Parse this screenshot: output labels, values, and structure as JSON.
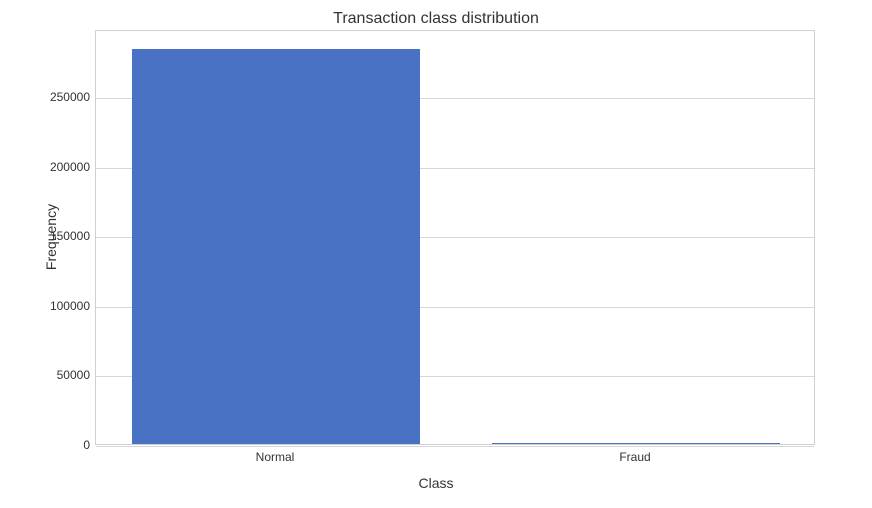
{
  "chart_data": {
    "type": "bar",
    "title": "Transaction class distribution",
    "xlabel": "Class",
    "ylabel": "Frequency",
    "categories": [
      "Normal",
      "Fraud"
    ],
    "values": [
      284315,
      492
    ],
    "ylim": [
      0,
      300000
    ],
    "yticks": [
      0,
      50000,
      100000,
      150000,
      200000,
      250000
    ],
    "bar_color": "#4a72c4"
  }
}
